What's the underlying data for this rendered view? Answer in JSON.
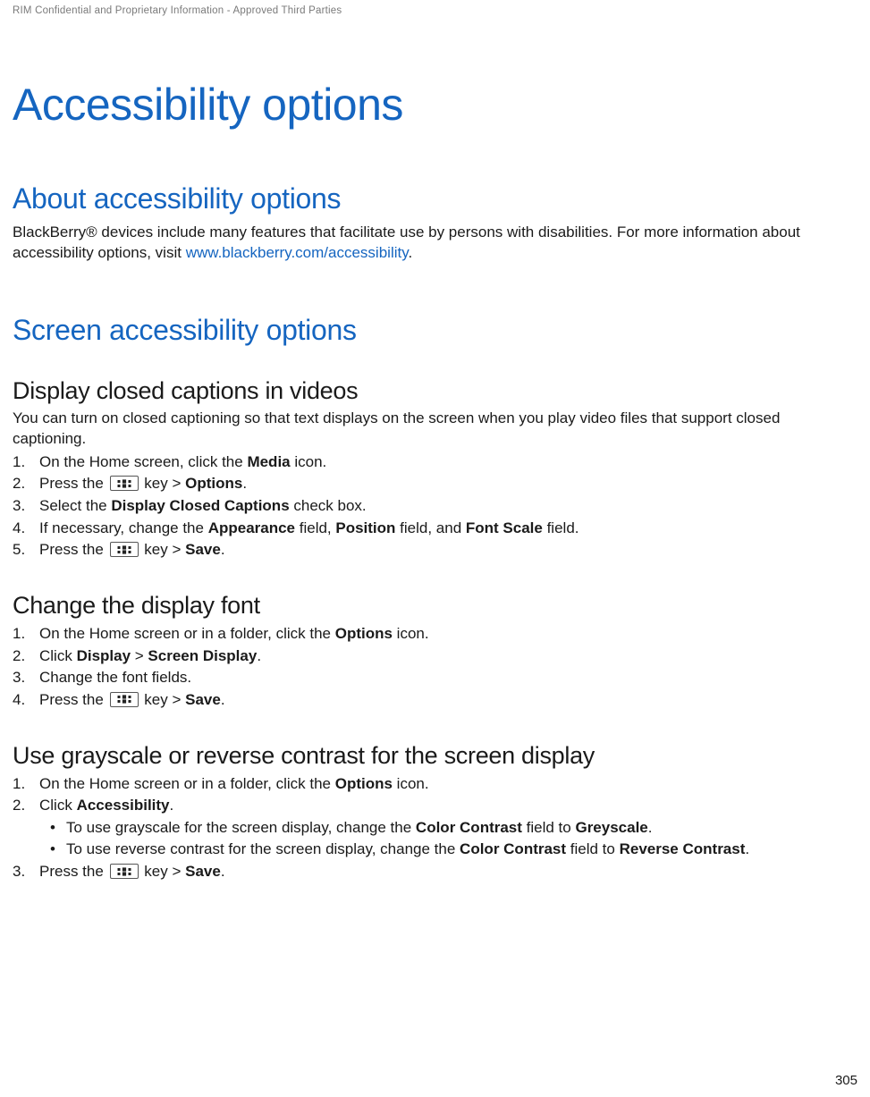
{
  "header": {
    "confidential": "RIM Confidential and Proprietary Information - Approved Third Parties"
  },
  "chapter_title": "Accessibility options",
  "sections": {
    "about": {
      "heading": "About accessibility options",
      "para_before_link": "BlackBerry® devices include many features that facilitate use by persons with disabilities. For more information about accessibility options, visit ",
      "link_text": "www.blackberry.com/accessibility",
      "para_after_link": "."
    },
    "screen": {
      "heading": "Screen accessibility options",
      "closed_captions": {
        "heading": "Display closed captions in videos",
        "intro": "You can turn on closed captioning so that text displays on the screen when you play video files that support closed captioning.",
        "s1_a": "On the Home screen, click the ",
        "s1_b": "Media",
        "s1_c": " icon.",
        "s2_a": "Press the ",
        "s2_b": " key > ",
        "s2_c": "Options",
        "s2_d": ".",
        "s3_a": "Select the ",
        "s3_b": "Display Closed Captions",
        "s3_c": " check box.",
        "s4_a": "If necessary, change the ",
        "s4_b": "Appearance",
        "s4_c": " field, ",
        "s4_d": "Position",
        "s4_e": " field, and ",
        "s4_f": "Font Scale",
        "s4_g": " field.",
        "s5_a": "Press the ",
        "s5_b": " key > ",
        "s5_c": "Save",
        "s5_d": "."
      },
      "display_font": {
        "heading": "Change the display font",
        "s1_a": "On the Home screen or in a folder, click the ",
        "s1_b": "Options",
        "s1_c": " icon.",
        "s2_a": "Click ",
        "s2_b": "Display",
        "s2_c": " > ",
        "s2_d": "Screen Display",
        "s2_e": ".",
        "s3_a": "Change the font fields.",
        "s4_a": "Press the ",
        "s4_b": " key > ",
        "s4_c": "Save",
        "s4_d": "."
      },
      "grayscale": {
        "heading": "Use grayscale or reverse contrast for the screen display",
        "s1_a": "On the Home screen or in a folder, click the ",
        "s1_b": "Options",
        "s1_c": " icon.",
        "s2_a": "Click ",
        "s2_b": "Accessibility",
        "s2_c": ".",
        "b1_a": "To use grayscale for the screen display, change the ",
        "b1_b": "Color Contrast",
        "b1_c": " field to ",
        "b1_d": "Greyscale",
        "b1_e": ".",
        "b2_a": "To use reverse contrast for the screen display, change the ",
        "b2_b": "Color Contrast",
        "b2_c": " field to ",
        "b2_d": "Reverse Contrast",
        "b2_e": ".",
        "s3_a": "Press the ",
        "s3_b": " key > ",
        "s3_c": "Save",
        "s3_d": "."
      }
    }
  },
  "page_number": "305"
}
